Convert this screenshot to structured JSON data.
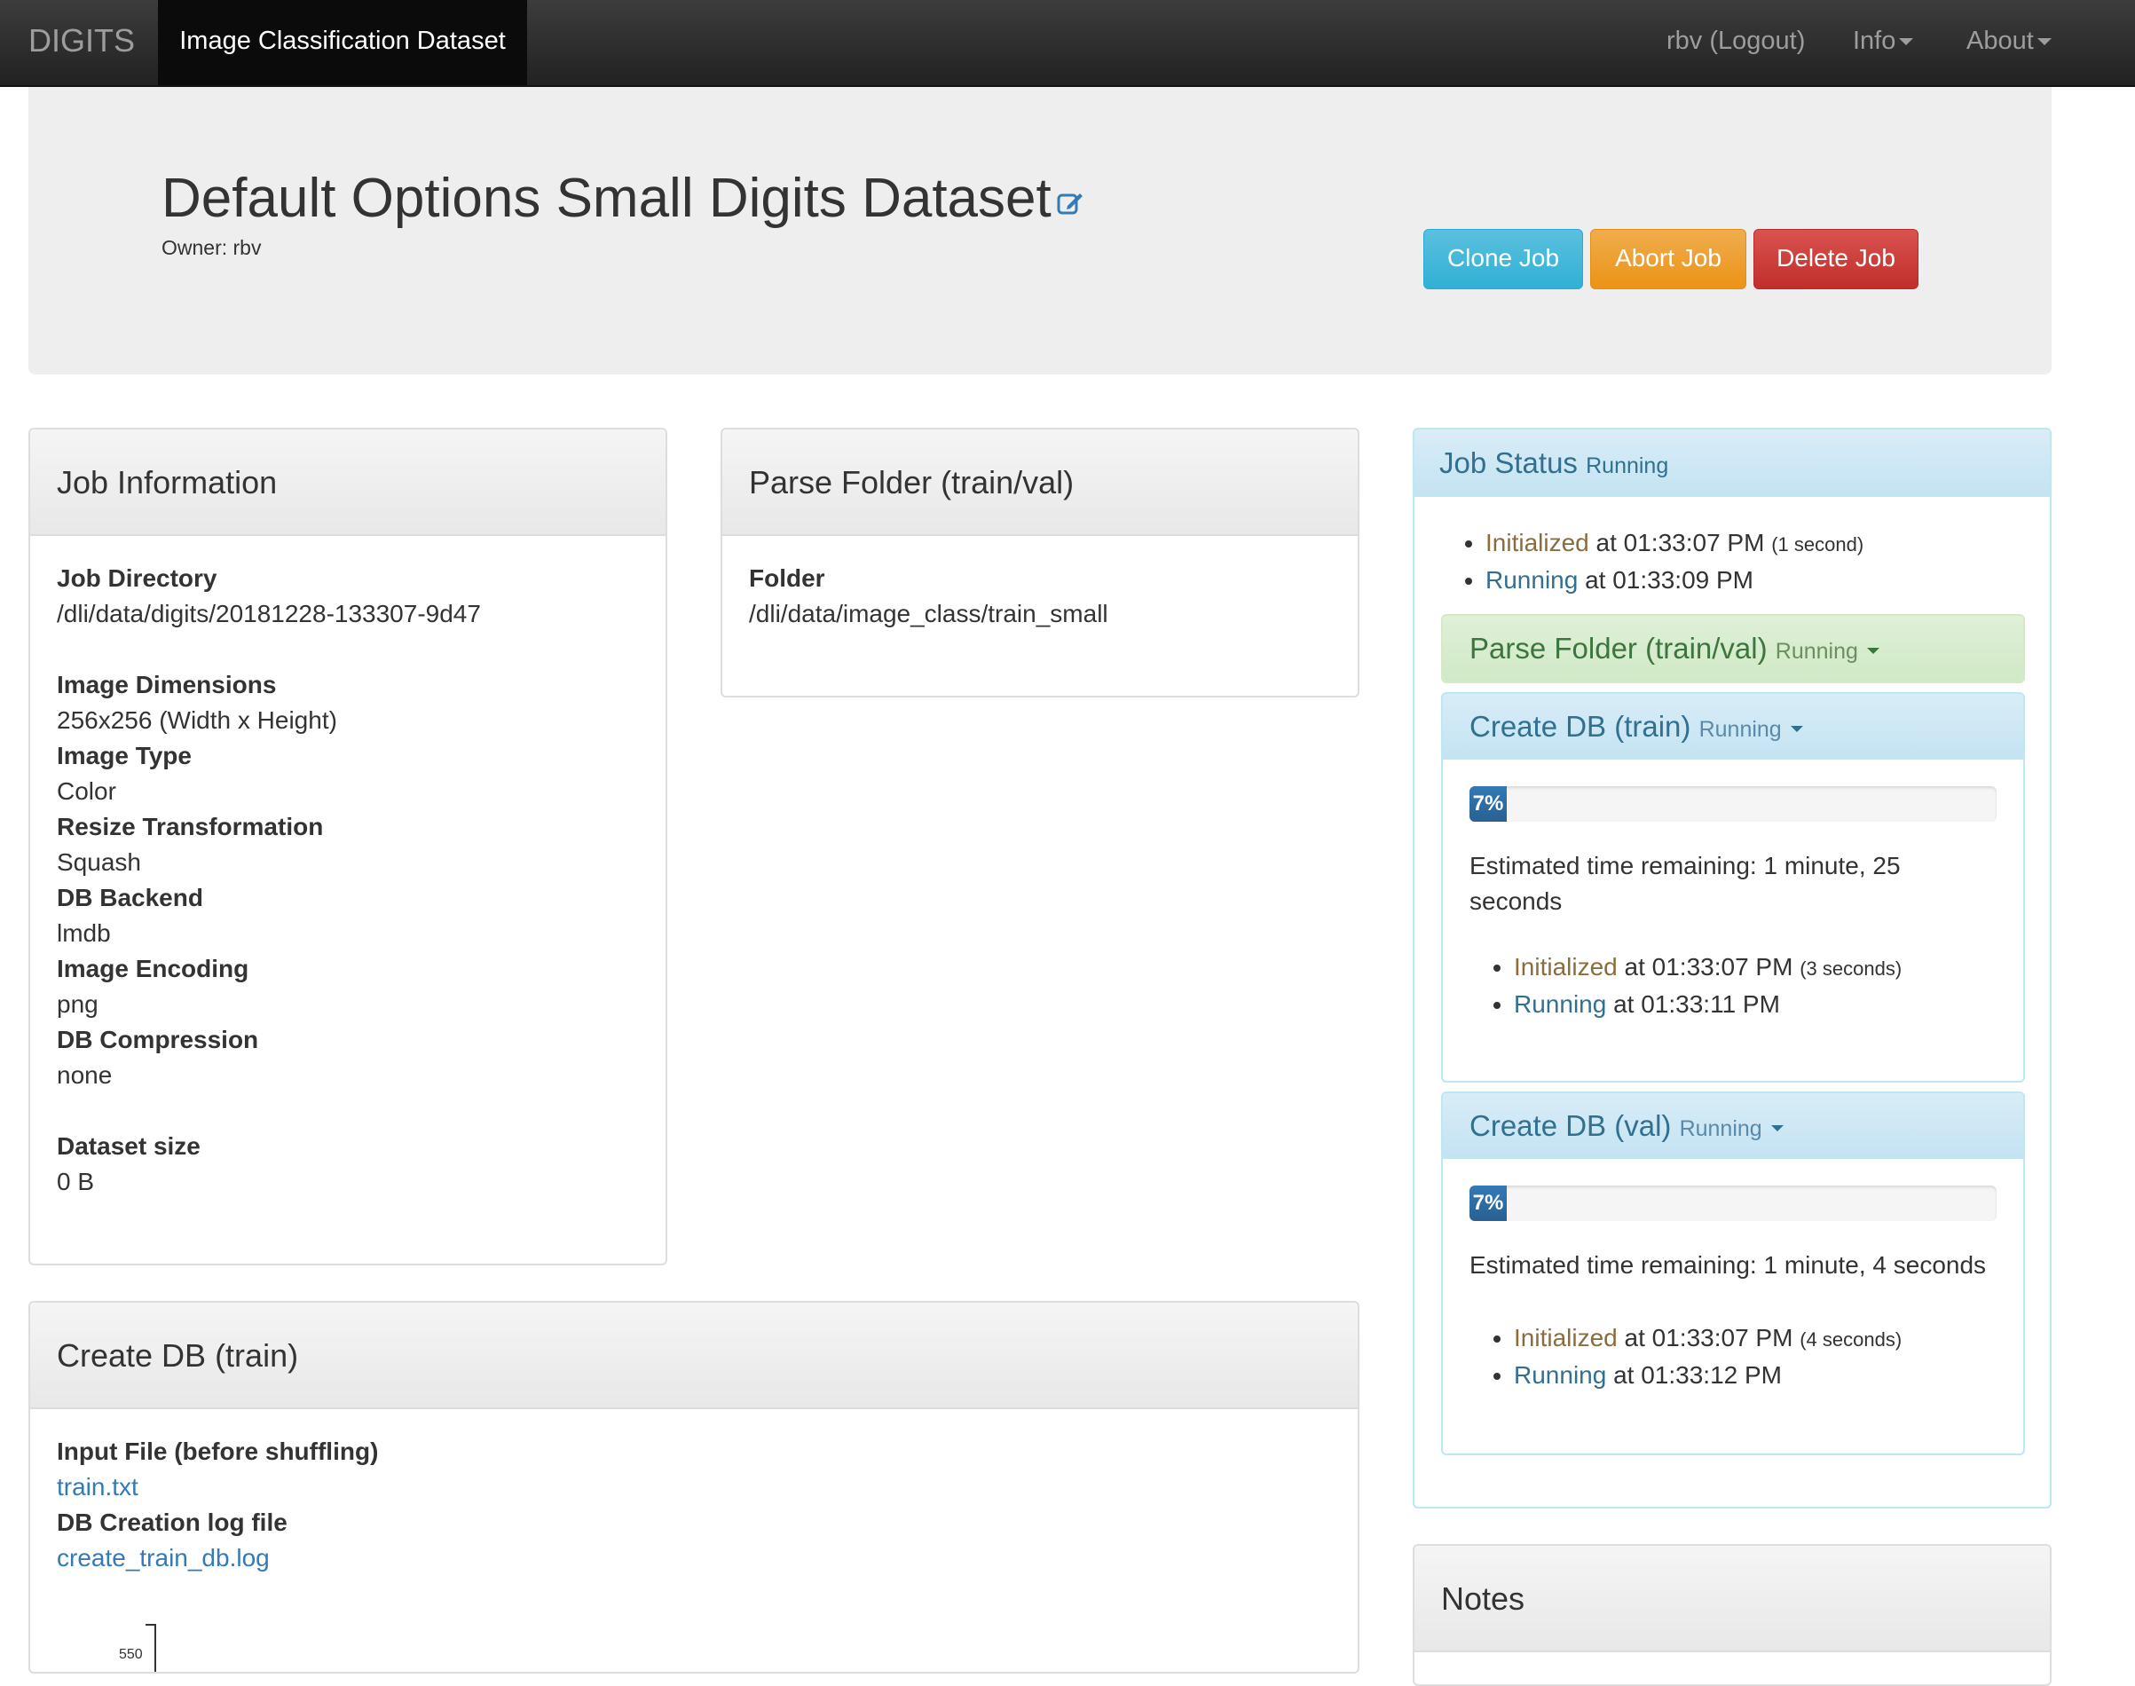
{
  "navbar": {
    "brand": "DIGITS",
    "active_tab": "Image Classification Dataset",
    "user_link": "rbv (Logout)",
    "info_menu": "Info",
    "about_menu": "About"
  },
  "header": {
    "title": "Default Options Small Digits Dataset",
    "owner": "Owner: rbv",
    "clone_label": "Clone Job",
    "abort_label": "Abort Job",
    "delete_label": "Delete Job",
    "colors": {
      "clone": "#5bc0de",
      "abort": "#f0ad4e",
      "delete": "#d9534f"
    }
  },
  "job_info": {
    "heading": "Job Information",
    "fields": [
      {
        "label": "Job Directory",
        "value": "/dli/data/digits/20181228-133307-9d47"
      },
      {
        "label": "Image Dimensions",
        "value": "256x256 (Width x Height)"
      },
      {
        "label": "Image Type",
        "value": "Color"
      },
      {
        "label": "Resize Transformation",
        "value": "Squash"
      },
      {
        "label": "DB Backend",
        "value": "lmdb"
      },
      {
        "label": "Image Encoding",
        "value": "png"
      },
      {
        "label": "DB Compression",
        "value": "none"
      },
      {
        "label": "Dataset size",
        "value": "0 B"
      }
    ]
  },
  "parse_folder": {
    "heading": "Parse Folder (train/val)",
    "folder_label": "Folder",
    "folder_value": "/dli/data/image_class/train_small"
  },
  "create_db_train_panel": {
    "heading": "Create DB (train)",
    "input_label": "Input File (before shuffling)",
    "input_link": "train.txt",
    "log_label": "DB Creation log file",
    "log_link": "create_train_db.log",
    "chart_tick": "550"
  },
  "job_status": {
    "heading": "Job Status",
    "state": "Running",
    "events": [
      {
        "state": "Initialized",
        "text": " at 01:33:07 PM ",
        "duration": "(1 second)"
      },
      {
        "state": "Running",
        "text": " at 01:33:09 PM",
        "duration": ""
      }
    ],
    "parse_folder": {
      "title": "Parse Folder (train/val)",
      "state": "Running"
    },
    "create_train": {
      "title": "Create DB (train)",
      "state": "Running",
      "progress_label": "7%",
      "progress": 7,
      "eta": "Estimated time remaining: 1 minute, 25 seconds",
      "events": [
        {
          "state": "Initialized",
          "text": " at 01:33:07 PM ",
          "duration": "(3 seconds)"
        },
        {
          "state": "Running",
          "text": " at 01:33:11 PM",
          "duration": ""
        }
      ]
    },
    "create_val": {
      "title": "Create DB (val)",
      "state": "Running",
      "progress_label": "7%",
      "progress": 7,
      "eta": "Estimated time remaining: 1 minute, 4 seconds",
      "events": [
        {
          "state": "Initialized",
          "text": " at 01:33:07 PM ",
          "duration": "(4 seconds)"
        },
        {
          "state": "Running",
          "text": " at 01:33:12 PM",
          "duration": ""
        }
      ]
    }
  },
  "notes": {
    "heading": "Notes"
  }
}
